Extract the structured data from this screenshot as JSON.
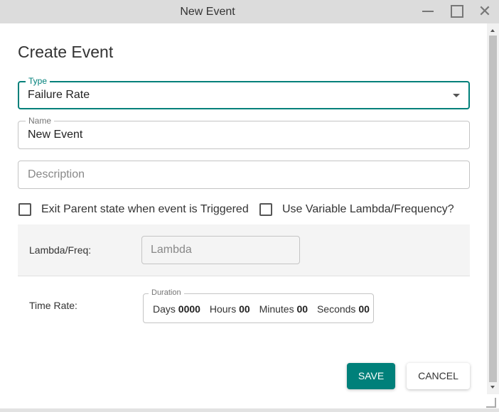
{
  "window": {
    "title": "New Event",
    "icons": {
      "minimize": "minimize-icon",
      "maximize": "maximize-icon",
      "close": "close-icon"
    }
  },
  "dialog": {
    "heading": "Create Event",
    "type_field": {
      "label": "Type",
      "value": "Failure Rate"
    },
    "name_field": {
      "label": "Name",
      "value": "New Event"
    },
    "description_field": {
      "placeholder": "Description"
    },
    "checkboxes": [
      {
        "label": "Exit Parent state when event is Triggered",
        "checked": false
      },
      {
        "label": "Use Variable Lambda/Frequency?",
        "checked": false
      }
    ],
    "lambda": {
      "label": "Lambda/Freq:",
      "placeholder": "Lambda"
    },
    "time_rate": {
      "label": "Time Rate:",
      "duration_label": "Duration",
      "days_label": "Days",
      "days_value": "0000",
      "hours_label": "Hours",
      "hours_value": "00",
      "minutes_label": "Minutes",
      "minutes_value": "00",
      "seconds_label": "Seconds",
      "seconds_value": "00"
    },
    "buttons": {
      "save": "SAVE",
      "cancel": "CANCEL"
    }
  },
  "colors": {
    "accent": "#00807a",
    "titlebar": "#dcdcdc",
    "panel": "#f4f4f4"
  }
}
